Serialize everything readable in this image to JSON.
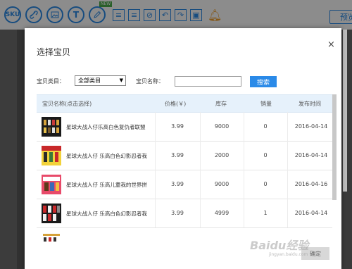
{
  "toolbar": {
    "sku_label": "SKU",
    "text_label": "T",
    "new_badge": "NEW",
    "preview_label": "预览"
  },
  "dialog": {
    "title": "选择宝贝",
    "close": "×",
    "filter": {
      "category_label": "宝贝类目：",
      "category_value": "全部类目",
      "name_label": "宝贝名称：",
      "name_value": "",
      "search_label": "搜索"
    },
    "columns": [
      "宝贝名称(点击选择)",
      "价格(￥)",
      "库存",
      "销量",
      "发布时间"
    ],
    "rows": [
      {
        "name": "星球大战人仔乐高白色复仇者联盟",
        "price": "3.99",
        "stock": "9000",
        "sales": "0",
        "date": "2016-04-14"
      },
      {
        "name": "星球大战人仔 乐高白色幻影忍者我",
        "price": "3.99",
        "stock": "2000",
        "sales": "0",
        "date": "2016-04-14"
      },
      {
        "name": "星球大战人仔 乐高儿童我的世界拼",
        "price": "3.99",
        "stock": "9000",
        "sales": "0",
        "date": "2016-04-16"
      },
      {
        "name": "星球大战人仔 乐高白色幻影忍者我",
        "price": "3.99",
        "stock": "4999",
        "sales": "1",
        "date": "2016-04-14"
      }
    ],
    "confirm_label": "确定"
  },
  "watermark": {
    "main": "Baidu经验",
    "sub": "jingyan.baidu.com"
  },
  "colors": {
    "accent": "#2a8ae8",
    "header_bg": "#e6f1fb",
    "bell": "#f0a030"
  }
}
